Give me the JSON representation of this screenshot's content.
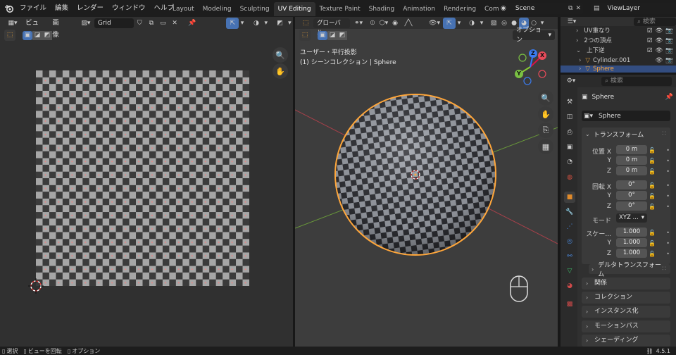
{
  "topbar": {
    "menus": [
      "ファイル",
      "編集",
      "レンダー",
      "ウィンドウ",
      "ヘルプ"
    ],
    "workspaces": [
      {
        "label": "Layout",
        "active": false
      },
      {
        "label": "Modeling",
        "active": false
      },
      {
        "label": "Sculpting",
        "active": false
      },
      {
        "label": "UV Editing",
        "active": true
      },
      {
        "label": "Texture Paint",
        "active": false
      },
      {
        "label": "Shading",
        "active": false
      },
      {
        "label": "Animation",
        "active": false
      },
      {
        "label": "Rendering",
        "active": false
      },
      {
        "label": "Compositin",
        "active": false
      }
    ],
    "scene": "Scene",
    "view_layer": "ViewLayer"
  },
  "uv_editor": {
    "menus": [
      "ビュー",
      "画像"
    ],
    "image_name": "Grid"
  },
  "viewport": {
    "mode": "グローバル",
    "options_label": "オプション",
    "view_name": "ユーザー・平行投影",
    "collection_info": "(1) シーンコレクション | Sphere",
    "gizmo": {
      "x": "X",
      "y": "Y",
      "z": "Z"
    }
  },
  "outliner": {
    "search_placeholder": "検索",
    "rows": [
      {
        "label": "UV重なり"
      },
      {
        "label": "2つの頂点"
      },
      {
        "label": "上下逆"
      },
      {
        "label": "Cylinder.001"
      },
      {
        "label": "Sphere"
      }
    ]
  },
  "properties": {
    "search_placeholder": "検索",
    "object_name": "Sphere",
    "data_name": "Sphere",
    "transform_title": "トランスフォーム",
    "location_label": "位置 X",
    "location": [
      "0 m",
      "0 m",
      "0 m"
    ],
    "rotation_label": "回転 X",
    "rotation": [
      "0°",
      "0°",
      "0°"
    ],
    "mode_label": "モード",
    "mode_value": "XYZ ...",
    "scale_label": "スケー...",
    "scale": [
      "1.000",
      "1.000",
      "1.000"
    ],
    "y_label": "Y",
    "z_label": "Z",
    "delta_transform": "デルタトランスフォーム",
    "panels": [
      "関係",
      "コレクション",
      "インスタンス化",
      "モーションパス",
      "シェーディング"
    ]
  },
  "statusbar": {
    "select": "選択",
    "rotate_view": "ビューを回転",
    "options": "オプション",
    "version": "4.5.1"
  },
  "colors": {
    "accent": "#4772b3",
    "selection": "#ffa63a"
  }
}
